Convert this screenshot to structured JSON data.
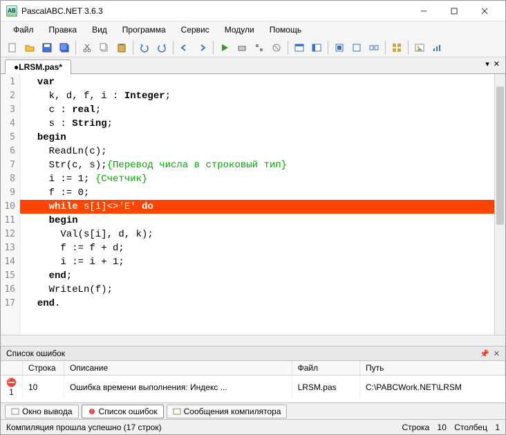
{
  "title": "PascalABC.NET 3.6.3",
  "menu": [
    "Файл",
    "Правка",
    "Вид",
    "Программа",
    "Сервис",
    "Модули",
    "Помощь"
  ],
  "toolbar_icons": [
    "new",
    "open",
    "save",
    "saveall",
    "cut",
    "copy",
    "paste",
    "undo",
    "redo",
    "nav1",
    "nav2",
    "run",
    "debug",
    "step",
    "stop",
    "form1",
    "form2",
    "box1",
    "box2",
    "box3",
    "grid",
    "img",
    "chart"
  ],
  "tab": "●LRSM.pas*",
  "code_lines": [
    {
      "n": 1,
      "segs": [
        [
          "  ",
          ""
        ],
        [
          "var",
          "kw"
        ]
      ]
    },
    {
      "n": 2,
      "segs": [
        [
          "    k, d, f, i : ",
          ""
        ],
        [
          "Integer",
          "ty"
        ],
        [
          ";",
          ""
        ]
      ]
    },
    {
      "n": 3,
      "segs": [
        [
          "    c : ",
          ""
        ],
        [
          "real",
          "ty"
        ],
        [
          ";",
          ""
        ]
      ]
    },
    {
      "n": 4,
      "segs": [
        [
          "    s : ",
          ""
        ],
        [
          "String",
          "ty"
        ],
        [
          ";",
          ""
        ]
      ]
    },
    {
      "n": 5,
      "segs": [
        [
          "  ",
          ""
        ],
        [
          "begin",
          "kw"
        ]
      ]
    },
    {
      "n": 6,
      "segs": [
        [
          "    ReadLn(c);",
          ""
        ]
      ]
    },
    {
      "n": 7,
      "segs": [
        [
          "    Str(c, s);",
          ""
        ],
        [
          "{Перевод числа в строковый тип}",
          "cm"
        ]
      ]
    },
    {
      "n": 8,
      "segs": [
        [
          "    i := 1; ",
          ""
        ],
        [
          "{Счетчик}",
          "cm"
        ]
      ]
    },
    {
      "n": 9,
      "segs": [
        [
          "    f := 0;",
          ""
        ]
      ]
    },
    {
      "n": 10,
      "err": true,
      "segs": [
        [
          "    ",
          ""
        ],
        [
          "while",
          "kw"
        ],
        [
          " s[i]<>",
          ""
        ],
        [
          "'E'",
          "str"
        ],
        [
          " ",
          ""
        ],
        [
          "do",
          "kw"
        ]
      ]
    },
    {
      "n": 11,
      "segs": [
        [
          "    ",
          ""
        ],
        [
          "begin",
          "kw"
        ]
      ]
    },
    {
      "n": 12,
      "segs": [
        [
          "      Val(s[i], d, k);",
          ""
        ]
      ]
    },
    {
      "n": 13,
      "segs": [
        [
          "      f := f + d;",
          ""
        ]
      ]
    },
    {
      "n": 14,
      "segs": [
        [
          "      i := i + 1;",
          ""
        ]
      ]
    },
    {
      "n": 15,
      "segs": [
        [
          "    ",
          ""
        ],
        [
          "end",
          "kw"
        ],
        [
          ";",
          ""
        ]
      ]
    },
    {
      "n": 16,
      "segs": [
        [
          "    WriteLn(f);",
          ""
        ]
      ]
    },
    {
      "n": 17,
      "segs": [
        [
          "  ",
          ""
        ],
        [
          "end",
          "kw"
        ],
        [
          ".",
          ""
        ]
      ]
    }
  ],
  "error_panel": {
    "title": "Список ошибок",
    "headers": [
      "",
      "Строка",
      "Описание",
      "Файл",
      "Путь"
    ],
    "rows": [
      {
        "num": "1",
        "line": "10",
        "desc": "Ошибка времени выполнения: Индекс ...",
        "file": "LRSM.pas",
        "path": "C:\\PABCWork.NET\\LRSM"
      }
    ]
  },
  "bottom_tabs": [
    {
      "label": "Окно вывода",
      "active": false
    },
    {
      "label": "Список ошибок",
      "active": true
    },
    {
      "label": "Сообщения компилятора",
      "active": false
    }
  ],
  "status": {
    "left": "Компиляция прошла успешно (17 строк)",
    "line_lbl": "Строка",
    "line_val": "10",
    "col_lbl": "Столбец",
    "col_val": "1"
  }
}
